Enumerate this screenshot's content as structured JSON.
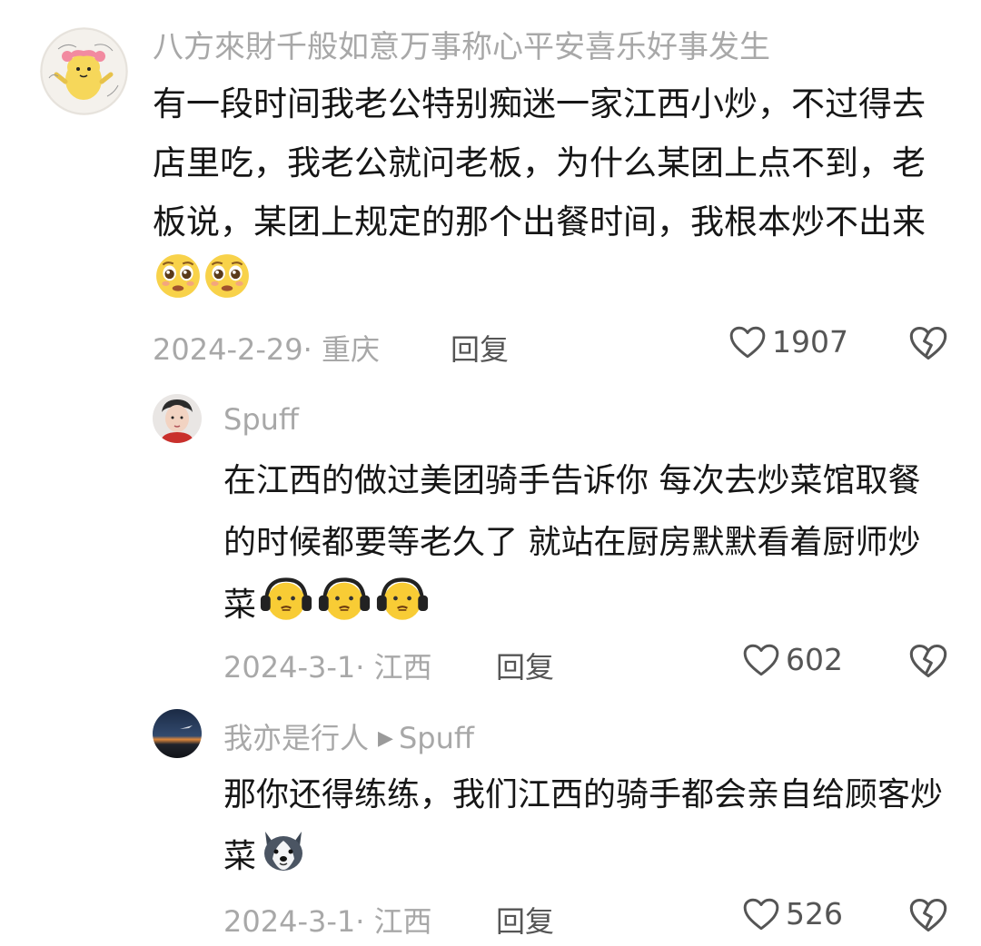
{
  "comments": [
    {
      "username": "八方來財千般如意万事称心平安喜乐好事发生",
      "text": "有一段时间我老公特别痴迷一家江西小炒，不过得去店里吃，我老公就问老板，为什么某团上点不到，老板说，某团上规定的那个出餐时间，我根本炒不出来",
      "emojis": [
        "pleading-face",
        "pleading-face"
      ],
      "date": "2024-2-29·",
      "location": "重庆",
      "reply_label": "回复",
      "likes": "1907"
    },
    {
      "username": "Spuff",
      "text": "在江西的做过美团骑手告诉你 每次去炒菜馆取餐的时候都要等老久了 就站在厨房默默看着厨师炒菜",
      "emojis": [
        "headphones-face",
        "headphones-face",
        "headphones-face"
      ],
      "date": "2024-3-1·",
      "location": "江西",
      "reply_label": "回复",
      "likes": "602"
    },
    {
      "username": "我亦是行人",
      "reply_to": "Spuff",
      "text": "那你还得练练，我们江西的骑手都会亲自给顾客炒菜",
      "emojis": [
        "husky-dog-face"
      ],
      "date": "2024-3-1·",
      "location": "江西",
      "reply_label": "回复",
      "likes": "526"
    }
  ]
}
